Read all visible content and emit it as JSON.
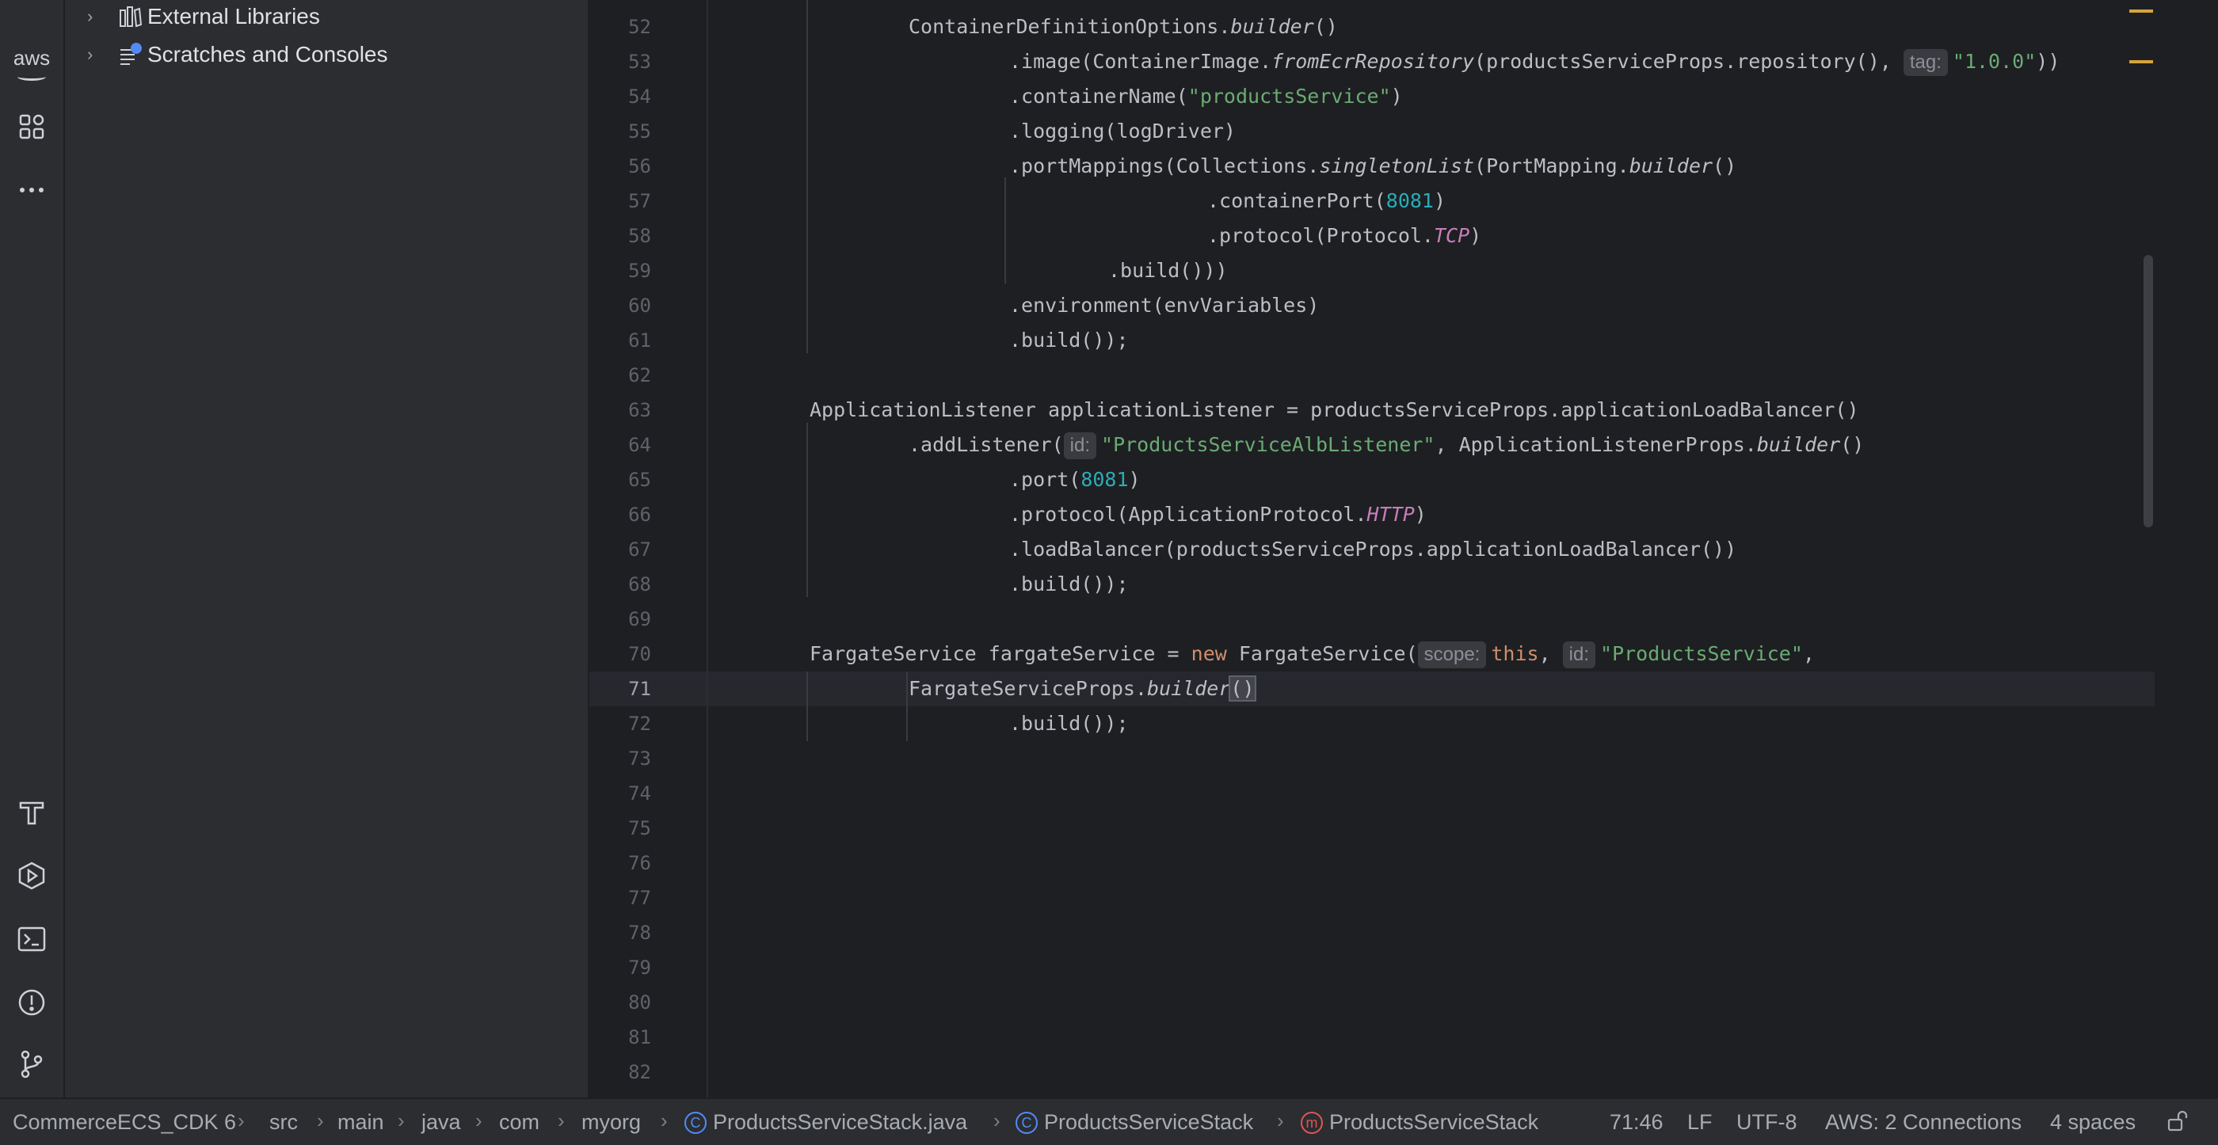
{
  "activity_bar": {
    "aws_label": "aws",
    "icons": [
      "aws-toolkit-icon",
      "structure-icon",
      "more-icon",
      "build-icon",
      "run-icon",
      "terminal-icon",
      "problems-icon",
      "git-icon"
    ]
  },
  "project_tree": {
    "items": [
      {
        "label": "External Libraries",
        "icon": "library-icon"
      },
      {
        "label": "Scratches and Consoles",
        "icon": "scratches-icon"
      }
    ]
  },
  "editor": {
    "current_line": "71",
    "line_numbers": [
      "52",
      "53",
      "54",
      "55",
      "56",
      "57",
      "58",
      "59",
      "60",
      "61",
      "62",
      "63",
      "64",
      "65",
      "66",
      "67",
      "68",
      "69",
      "70",
      "71",
      "72",
      "73",
      "74",
      "75",
      "76",
      "77",
      "78",
      "79",
      "80",
      "81",
      "82"
    ],
    "code": {
      "l52": "ContainerDefinitionOptions.",
      "l52b": "builder",
      "l52c": "()",
      "l53a": ".image(ContainerImage.",
      "l53b": "fromEcrRepository",
      "l53c": "(productsServiceProps.repository(), ",
      "l53hint": "tag:",
      "l53str": "\"1.0.0\"",
      "l53d": "))",
      "l54a": ".containerName(",
      "l54str": "\"productsService\"",
      "l54b": ")",
      "l55": ".logging(logDriver)",
      "l56a": ".portMappings(Collections.",
      "l56b": "singletonList",
      "l56c": "(PortMapping.",
      "l56d": "builder",
      "l56e": "()",
      "l57a": ".containerPort(",
      "l57num": "8081",
      "l57b": ")",
      "l58a": ".protocol(Protocol.",
      "l58const": "TCP",
      "l58b": ")",
      "l59": ".build()))",
      "l60": ".environment(envVariables)",
      "l61": ".build());",
      "l63": "ApplicationListener applicationListener = productsServiceProps.applicationLoadBalancer()",
      "l64a": ".addListener(",
      "l64hint": "id:",
      "l64str": "\"ProductsServiceAlbListener\"",
      "l64b": ", ApplicationListenerProps.",
      "l64c": "builder",
      "l64d": "()",
      "l65a": ".port(",
      "l65num": "8081",
      "l65b": ")",
      "l66a": ".protocol(ApplicationProtocol.",
      "l66const": "HTTP",
      "l66b": ")",
      "l67": ".loadBalancer(productsServiceProps.applicationLoadBalancer())",
      "l68": ".build());",
      "l70a": "FargateService fargateService = ",
      "l70kw": "new",
      "l70b": " FargateService(",
      "l70hint1": "scope:",
      "l70this": "this",
      "l70c": ", ",
      "l70hint2": "id:",
      "l70str": "\"ProductsService\"",
      "l70d": ",",
      "l71a": "FargateServiceProps.",
      "l71b": "builder",
      "l71c": "(",
      "l71d": ")",
      "l72": ".build());"
    }
  },
  "status_bar": {
    "breadcrumbs": [
      "CommerceECS_CDK 6",
      "src",
      "main",
      "java",
      "com",
      "myorg",
      "ProductsServiceStack.java",
      "ProductsServiceStack",
      "ProductsServiceStack"
    ],
    "crumb_icon_class": "C",
    "crumb_icon_method": "m",
    "position": "71:46",
    "line_separator": "LF",
    "encoding": "UTF-8",
    "aws_connections": "AWS: 2 Connections",
    "indent": "4 spaces"
  },
  "colors": {
    "background": "#1e1f22",
    "panel": "#2b2d30",
    "keyword": "#cf8e6d",
    "string": "#6aab73",
    "number": "#2aacb8",
    "constant": "#c77dbb"
  }
}
